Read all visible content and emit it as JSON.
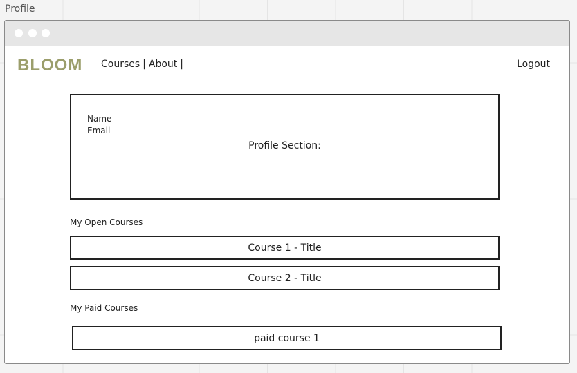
{
  "frame": {
    "label": "Profile"
  },
  "header": {
    "brand": "BLOOM",
    "nav": {
      "courses": "Courses",
      "separator": "|",
      "about": "About"
    },
    "logout": "Logout"
  },
  "profile": {
    "name_label": "Name",
    "email_label": "Email",
    "section_title": "Profile Section:"
  },
  "open_courses": {
    "label": "My Open Courses",
    "items": [
      "Course 1 - Title",
      "Course 2 - Title"
    ]
  },
  "paid_courses": {
    "label": "My Paid Courses",
    "items": [
      "paid course 1"
    ]
  },
  "colors": {
    "brand": "#9b9e6b",
    "border": "#222222",
    "titlebar": "#e6e6e6",
    "canvas": "#f4f4f4"
  }
}
